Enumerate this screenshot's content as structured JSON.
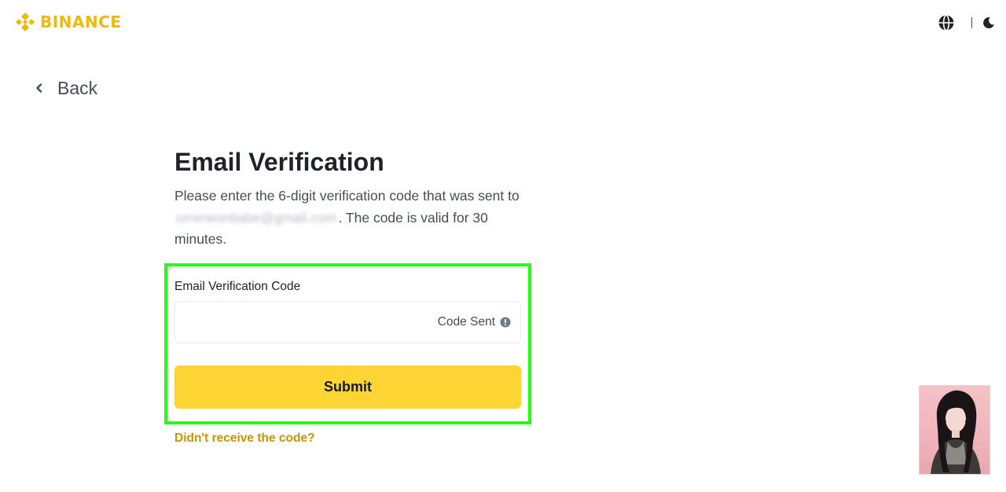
{
  "brand": {
    "name": "BINANCE",
    "color": "#f0b90b"
  },
  "header": {
    "language_icon": "globe-icon",
    "theme_icon": "moon-icon"
  },
  "nav": {
    "back_label": "Back"
  },
  "verification": {
    "title": "Email Verification",
    "instruction_part1": "Please enter the 6-digit verification code that was sent to",
    "masked_email": "orrerwontiabe@gmail.com",
    "instruction_part2": ". The code is valid for 30 minutes.",
    "field_label": "Email Verification Code",
    "code_value": "",
    "code_status": "Code Sent",
    "status_icon": "info-circle-icon",
    "submit_label": "Submit",
    "resend_link": "Didn't receive the code?"
  },
  "colors": {
    "accent_button": "#fcd535",
    "link": "#c99400",
    "highlight_box": "#22ff11"
  }
}
